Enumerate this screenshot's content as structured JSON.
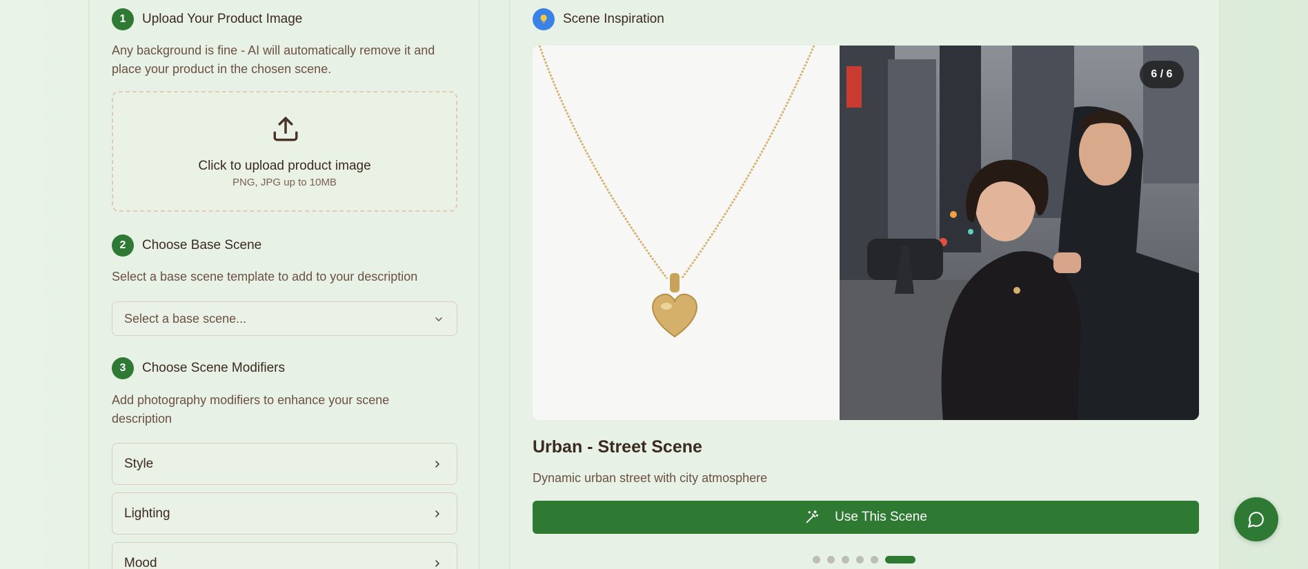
{
  "colors": {
    "accent_green": "#2e7a33",
    "info_blue": "#3b82e6",
    "text_dark": "#3a2a22",
    "text_muted": "#6b5044"
  },
  "left": {
    "step1": {
      "number": "1",
      "title": "Upload Your Product Image",
      "description": "Any background is fine - AI will automatically remove it and place your product in the chosen scene.",
      "upload": {
        "icon": "upload-icon",
        "main": "Click to upload product image",
        "sub": "PNG, JPG up to 10MB"
      }
    },
    "step2": {
      "number": "2",
      "title": "Choose Base Scene",
      "description": "Select a base scene template to add to your description",
      "select_placeholder": "Select a base scene..."
    },
    "step3": {
      "number": "3",
      "title": "Choose Scene Modifiers",
      "description": "Add photography modifiers to enhance your scene description",
      "modifiers": [
        "Style",
        "Lighting",
        "Mood"
      ]
    }
  },
  "right": {
    "header": {
      "icon": "lightbulb-icon",
      "title": "Scene Inspiration"
    },
    "counter": "6 / 6",
    "scene_name": "Urban - Street Scene",
    "scene_description": "Dynamic urban street with city atmosphere",
    "use_button": "Use This Scene",
    "carousel": {
      "total": 6,
      "active_index": 6
    }
  },
  "chat": {
    "icon": "chat-bubble-icon"
  }
}
